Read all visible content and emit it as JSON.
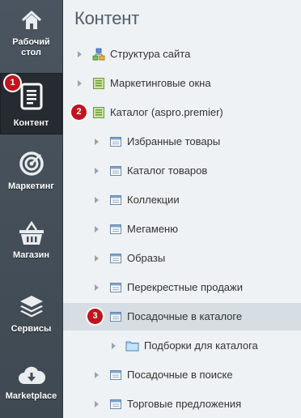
{
  "sidebar": {
    "items": [
      {
        "label_line1": "Рабочий",
        "label_line2": "стол",
        "icon": "home-icon"
      },
      {
        "label": "Контент",
        "icon": "document-icon",
        "active": true
      },
      {
        "label": "Маркетинг",
        "icon": "target-icon"
      },
      {
        "label": "Магазин",
        "icon": "basket-icon"
      },
      {
        "label": "Сервисы",
        "icon": "layers-icon"
      },
      {
        "label": "Marketplace",
        "icon": "cloud-download-icon"
      }
    ]
  },
  "header": {
    "title": "Контент"
  },
  "tree": [
    {
      "label": "Структура сайта",
      "icon": "site-structure-icon"
    },
    {
      "label": "Маркетинговые окна",
      "icon": "iblock-type-icon"
    },
    {
      "label": "Каталог (aspro.premier)",
      "icon": "iblock-type-icon"
    },
    {
      "label": "Избранные товары",
      "icon": "iblock-icon"
    },
    {
      "label": "Каталог товаров",
      "icon": "iblock-icon"
    },
    {
      "label": "Коллекции",
      "icon": "iblock-icon"
    },
    {
      "label": "Мегаменю",
      "icon": "iblock-icon"
    },
    {
      "label": "Образы",
      "icon": "iblock-icon"
    },
    {
      "label": "Перекрестные продажи",
      "icon": "iblock-icon"
    },
    {
      "label": "Посадочные в каталоге",
      "icon": "iblock-icon",
      "selected": true
    },
    {
      "label": "Подборки для каталога",
      "icon": "folder-icon"
    },
    {
      "label": "Посадочные в поиске",
      "icon": "iblock-icon"
    },
    {
      "label": "Торговые предложения",
      "icon": "iblock-icon"
    }
  ],
  "badges": [
    "1",
    "2",
    "3"
  ],
  "colors": {
    "badge": "#c0141e",
    "sidebar": "#444e58",
    "selected_row": "#d6dee3"
  }
}
